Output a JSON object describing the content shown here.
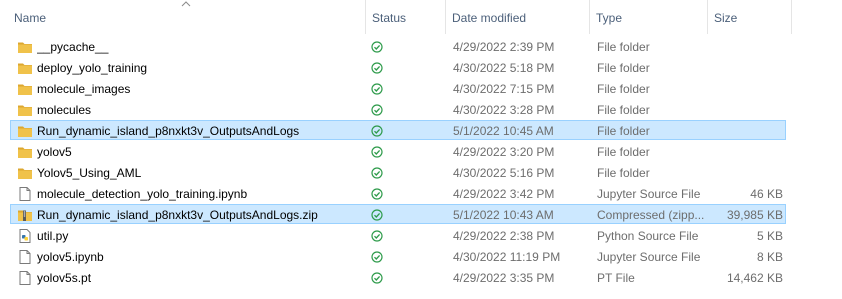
{
  "columns": {
    "name": "Name",
    "status": "Status",
    "date_modified": "Date modified",
    "type": "Type",
    "size": "Size"
  },
  "sort": {
    "column": "name",
    "direction": "ascending",
    "icon": "chevron-up-icon"
  },
  "status_icon": "sync-ok-icon",
  "colors": {
    "folder": "#f0c24a",
    "folder_dark": "#dca730",
    "status_ok": "#2e9b4b",
    "selection_bg": "#cce8ff",
    "selection_border": "#99d1ff",
    "header_text": "#4c607a",
    "meta_text": "#6d6d6d"
  },
  "files": [
    {
      "name": "__pycache__",
      "icon": "folder-icon",
      "date": "4/29/2022 2:39 PM",
      "type": "File folder",
      "size": "",
      "selected": false
    },
    {
      "name": "deploy_yolo_training",
      "icon": "folder-icon",
      "date": "4/30/2022 5:18 PM",
      "type": "File folder",
      "size": "",
      "selected": false
    },
    {
      "name": "molecule_images",
      "icon": "folder-icon",
      "date": "4/30/2022 7:15 PM",
      "type": "File folder",
      "size": "",
      "selected": false
    },
    {
      "name": "molecules",
      "icon": "folder-icon",
      "date": "4/30/2022 3:28 PM",
      "type": "File folder",
      "size": "",
      "selected": false
    },
    {
      "name": "Run_dynamic_island_p8nxkt3v_OutputsAndLogs",
      "icon": "folder-icon",
      "date": "5/1/2022 10:45 AM",
      "type": "File folder",
      "size": "",
      "selected": true
    },
    {
      "name": "yolov5",
      "icon": "folder-icon",
      "date": "4/29/2022 3:20 PM",
      "type": "File folder",
      "size": "",
      "selected": false
    },
    {
      "name": "Yolov5_Using_AML",
      "icon": "folder-icon",
      "date": "4/30/2022 5:16 PM",
      "type": "File folder",
      "size": "",
      "selected": false
    },
    {
      "name": "molecule_detection_yolo_training.ipynb",
      "icon": "document-icon",
      "date": "4/29/2022 3:42 PM",
      "type": "Jupyter Source File",
      "size": "46 KB",
      "selected": false
    },
    {
      "name": "Run_dynamic_island_p8nxkt3v_OutputsAndLogs.zip",
      "icon": "zip-icon",
      "date": "5/1/2022 10:43 AM",
      "type": "Compressed (zipp...",
      "size": "39,985 KB",
      "selected": true
    },
    {
      "name": "util.py",
      "icon": "python-file-icon",
      "date": "4/29/2022 2:38 PM",
      "type": "Python Source File",
      "size": "5 KB",
      "selected": false
    },
    {
      "name": "yolov5.ipynb",
      "icon": "document-icon",
      "date": "4/30/2022 11:19 PM",
      "type": "Jupyter Source File",
      "size": "8 KB",
      "selected": false
    },
    {
      "name": "yolov5s.pt",
      "icon": "document-icon",
      "date": "4/29/2022 3:35 PM",
      "type": "PT File",
      "size": "14,462 KB",
      "selected": false
    }
  ]
}
